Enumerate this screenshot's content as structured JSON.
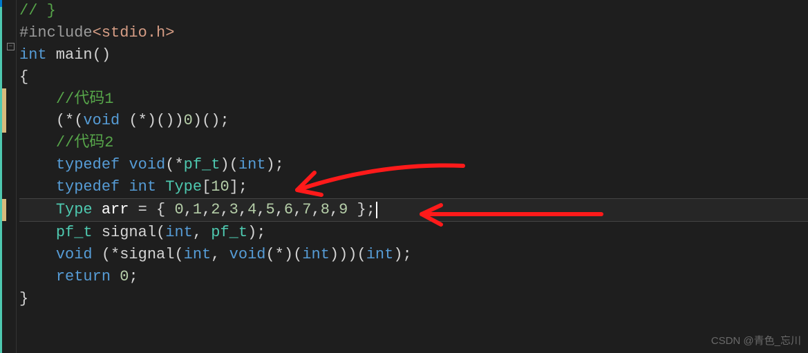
{
  "code": {
    "line1_partial": "// }",
    "include_directive": "#include",
    "include_path": "<stdio.h>",
    "int_kw": "int",
    "main_name": " main",
    "main_parens": "()",
    "open_brace": "{",
    "indent": "    ",
    "comment1": "//代码1",
    "cast_expr_a": "(*(",
    "void_kw": "void",
    "cast_expr_b": " (*)())",
    "zero": "0",
    "cast_expr_c": ")();",
    "comment2": "//代码2",
    "typedef_kw": "typedef",
    "pf_t_decl_a": "(*",
    "pf_t_name": "pf_t",
    "pf_t_decl_b": ")(",
    "pf_t_decl_c": ");",
    "type_name": " Type",
    "type_arr": "[",
    "ten": "10",
    "type_arr_end": "];",
    "Type_use": "Type",
    "arr_name": " arr",
    "arr_eq": " = { ",
    "n0": "0",
    "n1": "1",
    "n2": "2",
    "n3": "3",
    "n4": "4",
    "n5": "5",
    "n6": "6",
    "n7": "7",
    "n8": "8",
    "n9": "9",
    "comma": ",",
    "arr_end": " };",
    "signal_name": " signal",
    "signal_args_a": "(",
    "signal_args_b": ", ",
    "signal_args_c": ");",
    "sig2_a": " (*",
    "sig2_name": "signal",
    "sig2_b": "(",
    "sig2_c": ", ",
    "sig2_d": "(*)(",
    "sig2_e": ")))(",
    "sig2_f": ");",
    "return_kw": "return",
    "return_val": " 0",
    "semicolon": ";",
    "close_brace": "}"
  },
  "watermark": "CSDN @青色_忘川"
}
